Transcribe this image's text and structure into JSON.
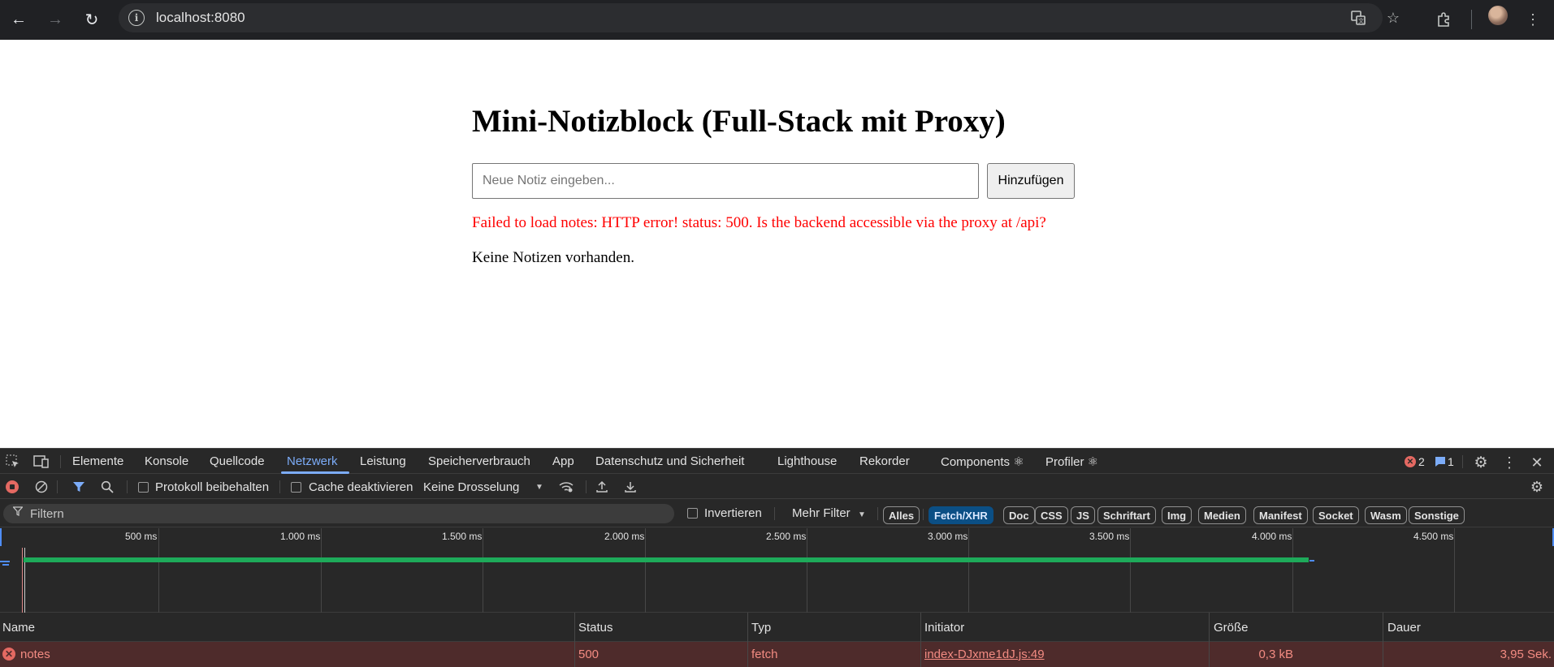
{
  "browser": {
    "url": "localhost:8080",
    "back_icon": "arrow-left-icon",
    "forward_icon": "arrow-right-icon",
    "reload_icon": "reload-icon"
  },
  "app": {
    "title": "Mini-Notizblock (Full-Stack mit Proxy)",
    "input_placeholder": "Neue Notiz eingeben...",
    "input_value": "",
    "add_button": "Hinzufügen",
    "error_message": "Failed to load notes: HTTP error! status: 500. Is the backend accessible via the proxy at /api?",
    "empty_message": "Keine Notizen vorhanden."
  },
  "devtools": {
    "tabs": [
      "Elemente",
      "Konsole",
      "Quellcode",
      "Netzwerk",
      "Leistung",
      "Speicherverbrauch",
      "App",
      "Datenschutz und Sicherheit",
      "Lighthouse",
      "Rekorder",
      "Components ⚛",
      "Profiler ⚛"
    ],
    "active_tab": "Netzwerk",
    "error_count": "2",
    "message_count": "1",
    "toolbar": {
      "preserve_log": "Protokoll beibehalten",
      "disable_cache": "Cache deaktivieren",
      "throttling": "Keine Drosselung"
    },
    "filterbar": {
      "filter_placeholder": "Filtern",
      "invert": "Invertieren",
      "more_filters": "Mehr Filter",
      "chips": [
        "Alles",
        "Fetch/XHR",
        "Doc",
        "CSS",
        "JS",
        "Schriftart",
        "Img",
        "Medien",
        "Manifest",
        "Socket",
        "Wasm",
        "Sonstige"
      ],
      "active_chip": "Fetch/XHR"
    },
    "timeline": {
      "ticks": [
        "500 ms",
        "1.000 ms",
        "1.500 ms",
        "2.000 ms",
        "2.500 ms",
        "3.000 ms",
        "3.500 ms",
        "4.000 ms",
        "4.500 ms"
      ]
    },
    "grid": {
      "columns": [
        "Name",
        "Status",
        "Typ",
        "Initiator",
        "Größe",
        "Dauer"
      ],
      "rows": [
        {
          "name": "notes",
          "status": "500",
          "type": "fetch",
          "initiator": "index-DJxme1dJ.js:49",
          "size": "0,3 kB",
          "duration": "3,95 Sek."
        }
      ]
    }
  },
  "colors": {
    "error_red": "#ff0000",
    "devtools_bg": "#282828",
    "active_tab": "#7cacf8",
    "error_row_bg": "#4e2b2b",
    "waterfall_green": "#1eaa5a"
  }
}
